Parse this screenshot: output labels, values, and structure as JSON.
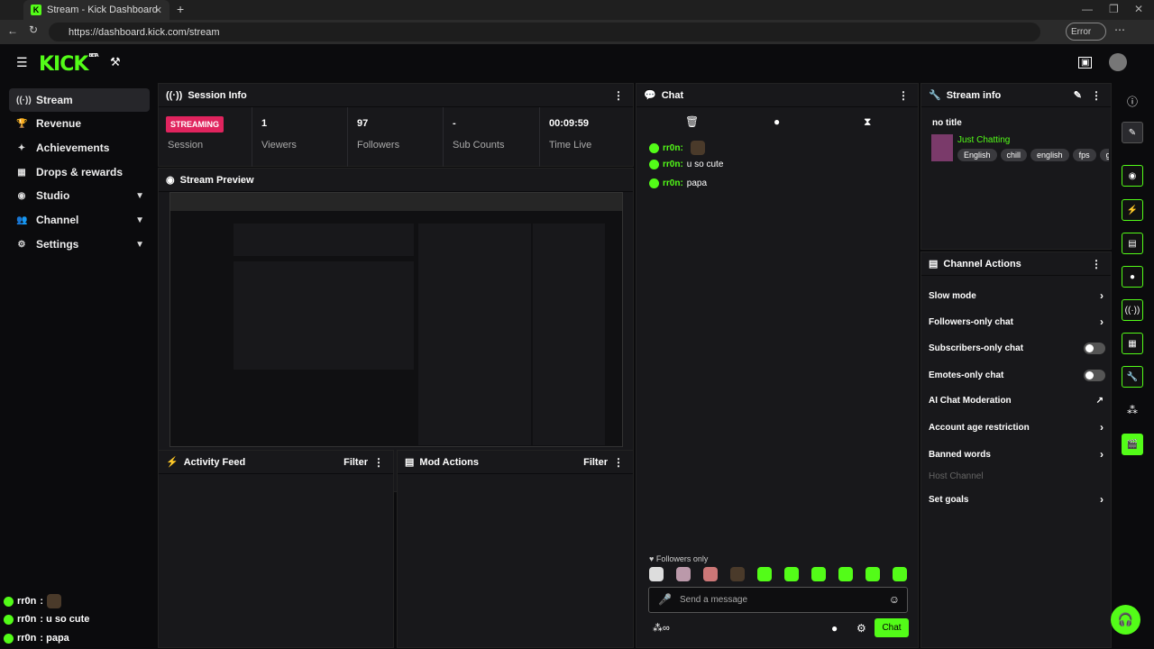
{
  "browser": {
    "tab_title": "Stream - Kick Dashboard",
    "url": "https://dashboard.kick.com/stream",
    "error_label": "Error"
  },
  "brand": {
    "logo": "KICK",
    "beta": "BETA",
    "accent": "#53fc18"
  },
  "sidebar": {
    "items": [
      {
        "label": "Stream",
        "icon": "broadcast-icon"
      },
      {
        "label": "Revenue",
        "icon": "trophy-icon"
      },
      {
        "label": "Achievements",
        "icon": "medal-icon"
      },
      {
        "label": "Drops & rewards",
        "icon": "gift-icon"
      },
      {
        "label": "Studio",
        "icon": "camera-icon"
      },
      {
        "label": "Channel",
        "icon": "users-icon"
      },
      {
        "label": "Settings",
        "icon": "gear-icon"
      }
    ],
    "chat": [
      {
        "user": "rr0n",
        "msg": ":"
      },
      {
        "user": "rr0n",
        "msg": ": u so cute"
      },
      {
        "user": "rr0n",
        "msg": ": papa"
      }
    ]
  },
  "session": {
    "title": "Session Info",
    "status": "STREAMING",
    "session_label": "Session",
    "stats": [
      {
        "value": "1",
        "label": "Viewers"
      },
      {
        "value": "97",
        "label": "Followers"
      },
      {
        "value": "-",
        "label": "Sub Counts"
      },
      {
        "value": "00:09:59",
        "label": "Time Live"
      }
    ]
  },
  "preview": {
    "title": "Stream Preview"
  },
  "activity": {
    "title": "Activity Feed",
    "filter": "Filter"
  },
  "mod": {
    "title": "Mod Actions",
    "filter": "Filter"
  },
  "chat": {
    "title": "Chat",
    "messages": [
      {
        "user": "rr0n:",
        "text": ""
      },
      {
        "user": "rr0n:",
        "text": "u so cute"
      },
      {
        "user": "rr0n:",
        "text": "papa"
      }
    ],
    "followers_only": "Followers only",
    "placeholder": "Send a message",
    "send": "Chat"
  },
  "streaminfo": {
    "title": "Stream info",
    "stream_title": "no title",
    "category": "Just Chatting",
    "tags": [
      "English",
      "chill",
      "english",
      "fps",
      "ga"
    ]
  },
  "actions": {
    "title": "Channel Actions",
    "items": [
      {
        "label": "Slow mode",
        "ctrl": "arrow"
      },
      {
        "label": "Followers-only chat",
        "ctrl": "arrow"
      },
      {
        "label": "Subscribers-only chat",
        "ctrl": "toggle"
      },
      {
        "label": "Emotes-only chat",
        "ctrl": "toggle"
      },
      {
        "label": "AI Chat Moderation",
        "ctrl": "external"
      },
      {
        "label": "Account age restriction",
        "ctrl": "arrow"
      },
      {
        "label": "Banned words",
        "ctrl": "arrow"
      },
      {
        "label": "Host Channel",
        "ctrl": "none",
        "disabled": true
      },
      {
        "label": "Set goals",
        "ctrl": "arrow"
      }
    ]
  }
}
